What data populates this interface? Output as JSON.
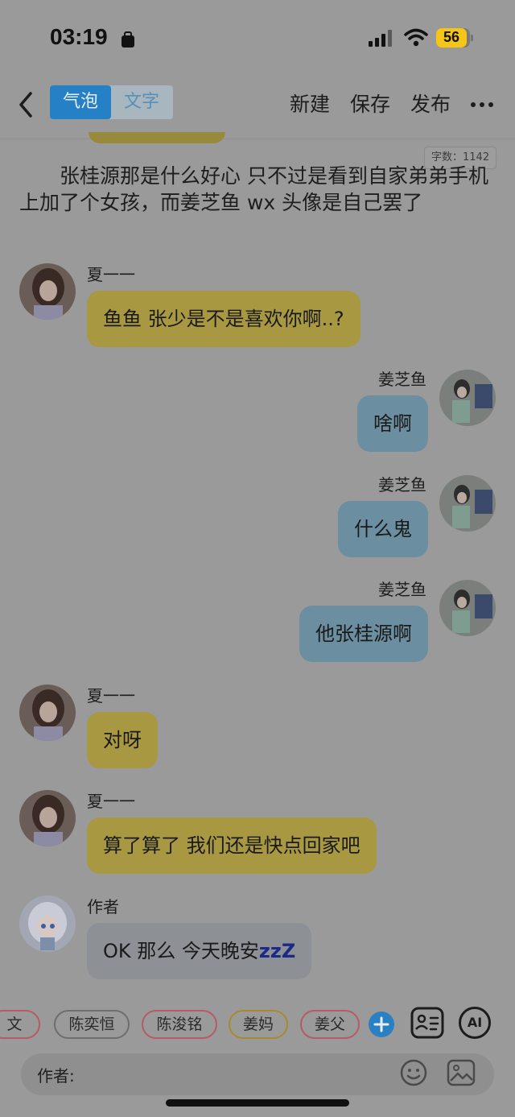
{
  "status_bar": {
    "time": "03:19",
    "battery": "56"
  },
  "nav": {
    "tabs": [
      {
        "label": "气泡",
        "active": true
      },
      {
        "label": "文字",
        "active": false
      }
    ],
    "new_label": "新建",
    "save_label": "保存",
    "publish_label": "发布"
  },
  "word_count": "字数：1142",
  "narration": "　　张桂源那是什么好心 只不过是看到自家弟弟手机上加了个女孩，而姜芝鱼 wx 头像是自己罢了",
  "messages": [
    {
      "sender": "夏一一",
      "text": "鱼鱼 张少是不是喜欢你啊..?"
    },
    {
      "sender": "姜芝鱼",
      "text": "啥啊"
    },
    {
      "sender": "姜芝鱼",
      "text": "什么鬼"
    },
    {
      "sender": "姜芝鱼",
      "text": "他张桂源啊"
    },
    {
      "sender": "夏一一",
      "text": "对呀"
    },
    {
      "sender": "夏一一",
      "text": "算了算了 我们还是快点回家吧"
    },
    {
      "sender": "作者",
      "text": "OK 那么 今天晚安",
      "suffix": "zzZ"
    }
  ],
  "characters": [
    {
      "name": "文",
      "color": "#b65a66"
    },
    {
      "name": "陈奕恒",
      "color": "#6e6e6e"
    },
    {
      "name": "陈浚铭",
      "color": "#b65a66"
    },
    {
      "name": "姜妈",
      "color": "#a88a2e"
    },
    {
      "name": "姜父",
      "color": "#b65a66"
    }
  ],
  "composer": {
    "label": "作者:"
  },
  "colors": {
    "accent": "#2580c6",
    "left_bubble": "#a89842",
    "right_bubble": "#6b8ea1",
    "author_bubble": "#8d9095"
  }
}
